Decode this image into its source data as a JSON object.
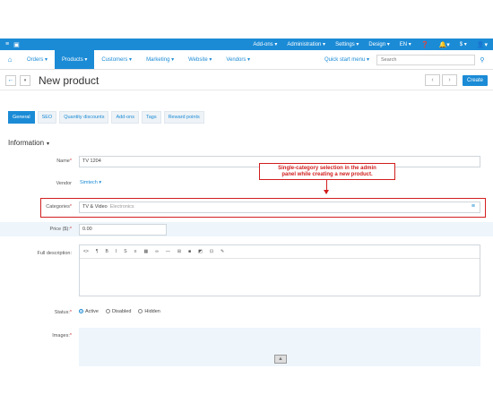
{
  "topbar": {
    "left_icons": [
      "menu-icon",
      "store-icon"
    ],
    "items": [
      "Add-ons ▾",
      "Administration ▾",
      "Settings ▾",
      "Design ▾",
      "EN ▾"
    ],
    "right_icons": [
      "help-icon",
      "bell-icon",
      "currency-icon",
      "user-icon"
    ],
    "bell_label": "▾",
    "currency_label": "$ ▾",
    "user_label": "▾"
  },
  "navbar": {
    "tabs": [
      "Orders ▾",
      "Products ▾",
      "Customers ▾",
      "Marketing ▾",
      "Website ▾",
      "Vendors ▾"
    ],
    "active_tab_index": 1,
    "quick_start": "Quick start menu ▾",
    "search_placeholder": "Search"
  },
  "titlebar": {
    "title": "New product",
    "create_label": "Create"
  },
  "subtabs": [
    "General",
    "SEO",
    "Quantity discounts",
    "Add-ons",
    "Tags",
    "Reward points"
  ],
  "section": {
    "title": "Information",
    "chevron": "▾"
  },
  "form": {
    "name_label": "Name",
    "name_value": "TV 1204",
    "vendor_label": "Vendor",
    "vendor_value": "Simtech ▾",
    "categories_label": "Categories",
    "category_value": "TV & Video",
    "category_parent": "Electronics",
    "price_label": "Price ($):",
    "price_value": "0.00",
    "description_label": "Full description:",
    "status_label": "Status:",
    "status_options": [
      "Active",
      "Disabled",
      "Hidden"
    ],
    "status_selected": "Active",
    "images_label": "Images:",
    "required_mark": "*"
  },
  "editor_toolbar": [
    "<>",
    "¶",
    "B",
    "I",
    "S",
    "≡",
    "▦",
    "∞",
    "—",
    "⊞",
    "■",
    "◩",
    "⊡",
    "✎"
  ],
  "annotation": {
    "text_line1": "Single-category selection in the admin",
    "text_line2": "panel while creating a new product.",
    "color": "#d21e1e"
  },
  "colors": {
    "accent": "#1b8bd6",
    "annotation": "#d21e1e"
  }
}
